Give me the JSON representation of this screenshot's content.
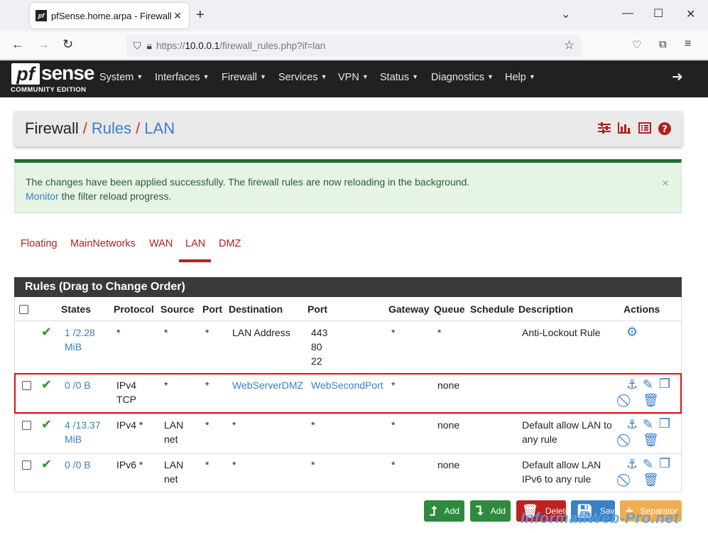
{
  "browser": {
    "tab_title": "pfSense.home.arpa - Firewall: Rules: LAN",
    "url_prefix": "https://",
    "url_host": "10.0.0.1",
    "url_path": "/firewall_rules.php?if=lan"
  },
  "nav": {
    "logo_pf": "pf",
    "logo_sense": "sense",
    "logo_edition": "COMMUNITY EDITION",
    "menus": [
      "System",
      "Interfaces",
      "Firewall",
      "Services",
      "VPN",
      "Status",
      "Diagnostics",
      "Help"
    ]
  },
  "breadcrumb": {
    "root": "Firewall",
    "mid": "Rules",
    "leaf": "LAN",
    "sep": "/"
  },
  "alert": {
    "line1": "The changes have been applied successfully. The firewall rules are now reloading in the background.",
    "link": "Monitor",
    "line2_rest": " the filter reload progress.",
    "close": "×"
  },
  "tabs": [
    "Floating",
    "MainNetworks",
    "WAN",
    "LAN",
    "DMZ"
  ],
  "active_tab": "LAN",
  "rules_panel": {
    "title": "Rules (Drag to Change Order)",
    "columns": [
      "States",
      "Protocol",
      "Source",
      "Port",
      "Destination",
      "Port",
      "Gateway",
      "Queue",
      "Schedule",
      "Description",
      "Actions"
    ]
  },
  "rows": [
    {
      "states1": "1 /2.28",
      "states2": "MiB",
      "proto1": "*",
      "proto2": "",
      "src1": "*",
      "src2": "",
      "sport": "*",
      "dest": "LAN Address",
      "dport1": "443",
      "dport2": "80",
      "dport3": "22",
      "gw": "*",
      "queue": "*",
      "desc1": "Anti-Lockout Rule",
      "desc2": ""
    },
    {
      "states1": "0 /0 B",
      "states2": "",
      "proto1": "IPv4",
      "proto2": "TCP",
      "src1": "*",
      "src2": "",
      "sport": "*",
      "dest": "WebServerDMZ",
      "dport1": "WebSecondPort",
      "dport2": "",
      "dport3": "",
      "gw": "*",
      "queue": "none",
      "desc1": "",
      "desc2": ""
    },
    {
      "states1": "4 /13.37",
      "states2": "MiB",
      "proto1": "IPv4 *",
      "proto2": "",
      "src1": "LAN",
      "src2": "net",
      "sport": "*",
      "dest": "*",
      "dport1": "*",
      "dport2": "",
      "dport3": "",
      "gw": "*",
      "queue": "none",
      "desc1": "Default allow LAN to",
      "desc2": "any rule"
    },
    {
      "states1": "0 /0 B",
      "states2": "",
      "proto1": "IPv6 *",
      "proto2": "",
      "src1": "LAN",
      "src2": "net",
      "sport": "*",
      "dest": "*",
      "dport1": "*",
      "dport2": "",
      "dport3": "",
      "gw": "*",
      "queue": "none",
      "desc1": "Default allow LAN",
      "desc2": "IPv6 to any rule"
    }
  ],
  "buttons": {
    "add_top": "Add",
    "add_bottom": "Add",
    "delete": "Delete",
    "save": "Save",
    "separator": "Separator"
  },
  "colors": {
    "nav_bg": "#212121",
    "accent_red": "#b42020",
    "link_blue": "#3a80c6",
    "success": "#2a9a2a",
    "btn_green": "#2e8b3e",
    "btn_red": "#c02020",
    "btn_blue": "#3a80c6",
    "btn_orange": "#f0ad4e"
  },
  "watermark": "InformatiWeb-Pro.net"
}
